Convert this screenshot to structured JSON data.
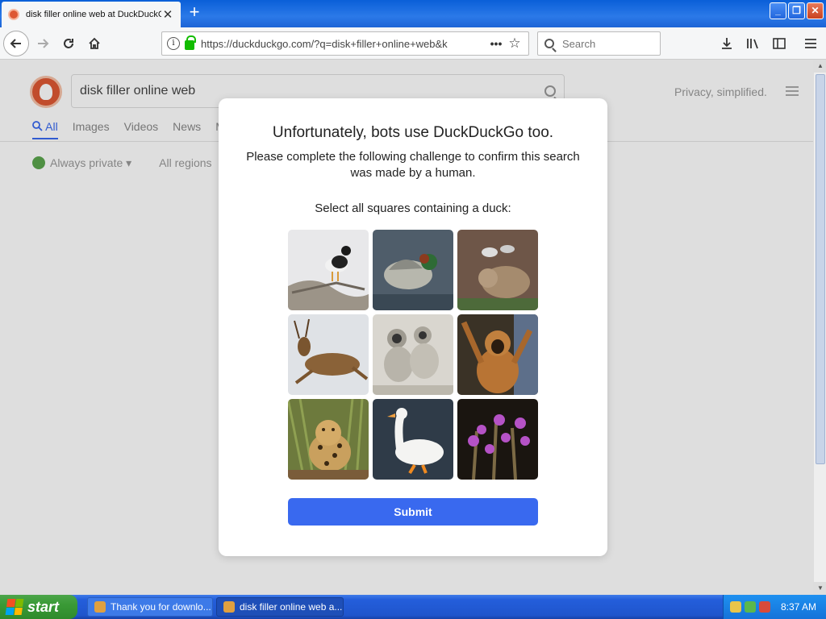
{
  "browser": {
    "tab_title": "disk filler online web at DuckDuckGo",
    "tab_close": "✕",
    "new_tab": "+",
    "window_buttons": {
      "minimize": "_",
      "maximize": "❐",
      "close": "✕"
    },
    "url": "https://duckduckgo.com/?q=disk+filler+online+web&k",
    "search_placeholder": "Search",
    "icons": {
      "back": "arrow-left",
      "forward": "arrow-right",
      "reload": "reload",
      "home": "home",
      "downloads": "download",
      "library": "library",
      "sidebar": "sidebar",
      "menu": "hamburger",
      "bookmark": "star"
    }
  },
  "ddg": {
    "search_value": "disk filler online web",
    "privacy_text": "Privacy, simplified.",
    "tabs": [
      "All",
      "Images",
      "Videos",
      "News",
      "M"
    ],
    "filters": [
      "Always private ▾",
      "All regions"
    ]
  },
  "challenge": {
    "title": "Unfortunately, bots use DuckDuckGo too.",
    "subtitle": "Please complete the following challenge to confirm this search was made by a human.",
    "prompt": "Select all squares containing a duck:",
    "images": [
      "duck on driftwood",
      "green-winged teal duck",
      "bear cub",
      "deer running",
      "monkeys grooming",
      "gibbon",
      "jaguar",
      "white duck",
      "purple flowers"
    ],
    "submit_label": "Submit"
  },
  "taskbar": {
    "start_label": "start",
    "items": [
      "Thank you for downlo...",
      "disk filler online web a..."
    ],
    "clock": "8:37 AM"
  },
  "colors": {
    "accent": "#3969ef",
    "ddg_orange": "#de5833",
    "xp_blue": "#245edb",
    "xp_green": "#3a9a36"
  }
}
